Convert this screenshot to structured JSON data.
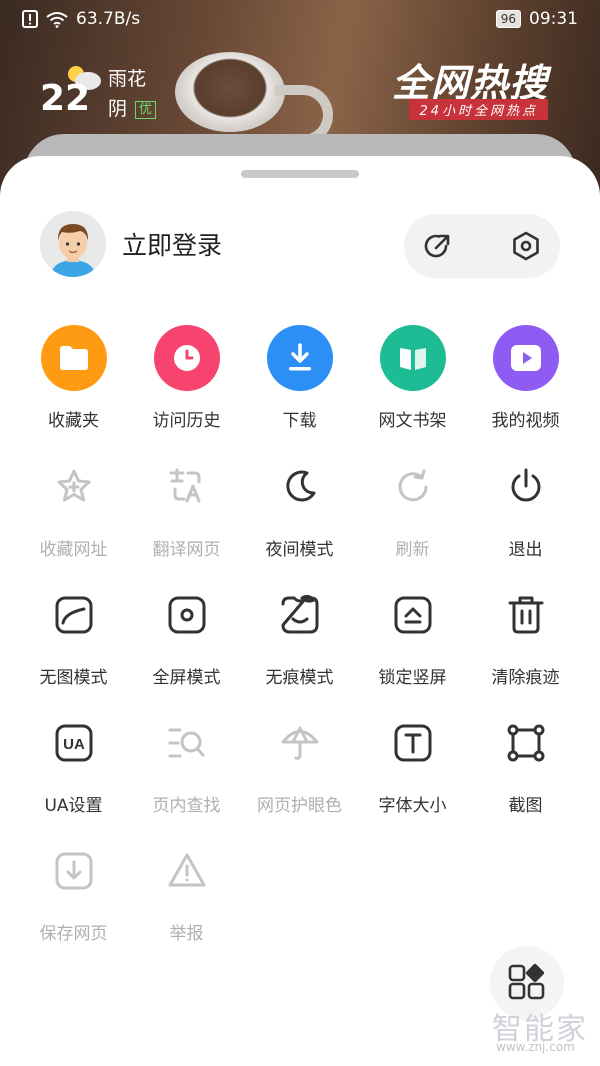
{
  "status": {
    "speed": "63.7B/s",
    "battery": "96",
    "time": "09:31"
  },
  "weather": {
    "temp": "22",
    "condition": "雨花",
    "sky": "阴",
    "aqi": "优"
  },
  "banner": {
    "title": "全网热搜",
    "subtitle": "24小时全网热点"
  },
  "login": {
    "label": "立即登录"
  },
  "quick": [
    {
      "label": "收藏夹",
      "color": "#ff9a13",
      "icon": "folder-icon"
    },
    {
      "label": "访问历史",
      "color": "#f6446f",
      "icon": "clock-icon"
    },
    {
      "label": "下载",
      "color": "#2c8ff5",
      "icon": "download-icon"
    },
    {
      "label": "网文书架",
      "color": "#1dbc94",
      "icon": "book-icon"
    },
    {
      "label": "我的视频",
      "color": "#8e5cf2",
      "icon": "video-icon"
    }
  ],
  "tools": [
    {
      "label": "收藏网址",
      "disabled": true,
      "icon": "star-plus-icon"
    },
    {
      "label": "翻译网页",
      "disabled": true,
      "icon": "translate-icon"
    },
    {
      "label": "夜间模式",
      "disabled": false,
      "icon": "moon-icon"
    },
    {
      "label": "刷新",
      "disabled": true,
      "icon": "refresh-icon"
    },
    {
      "label": "退出",
      "disabled": false,
      "icon": "power-icon"
    },
    {
      "label": "无图模式",
      "disabled": false,
      "icon": "no-image-icon"
    },
    {
      "label": "全屏模式",
      "disabled": false,
      "icon": "fullscreen-icon"
    },
    {
      "label": "无痕模式",
      "disabled": false,
      "icon": "incognito-icon"
    },
    {
      "label": "锁定竖屏",
      "disabled": false,
      "icon": "lock-portrait-icon"
    },
    {
      "label": "清除痕迹",
      "disabled": false,
      "icon": "trash-icon"
    },
    {
      "label": "UA设置",
      "disabled": false,
      "icon": "ua-icon"
    },
    {
      "label": "页内查找",
      "disabled": true,
      "icon": "find-in-page-icon"
    },
    {
      "label": "网页护眼色",
      "disabled": true,
      "icon": "umbrella-icon"
    },
    {
      "label": "字体大小",
      "disabled": false,
      "icon": "font-size-icon"
    },
    {
      "label": "截图",
      "disabled": false,
      "icon": "screenshot-icon"
    },
    {
      "label": "保存网页",
      "disabled": true,
      "icon": "save-page-icon"
    },
    {
      "label": "举报",
      "disabled": true,
      "icon": "warning-icon"
    }
  ],
  "watermark": {
    "text": "智能家",
    "url": "www.znj.com"
  }
}
